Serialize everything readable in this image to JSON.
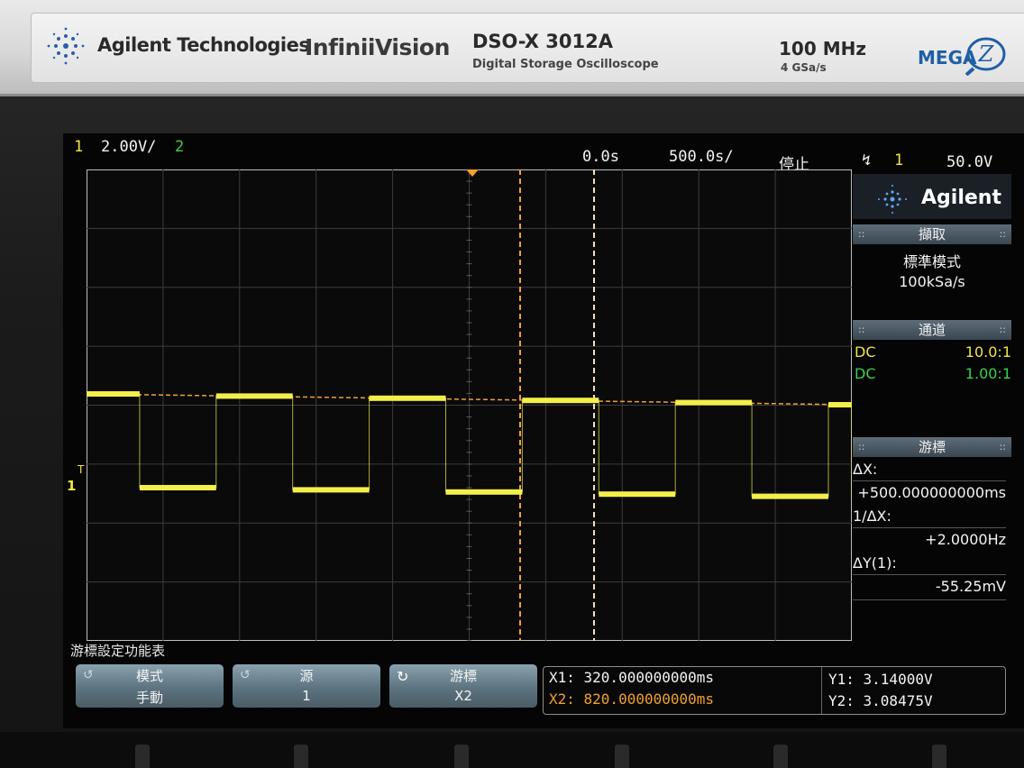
{
  "brand": {
    "maker": "Agilent Technologies",
    "series": "InfiniiVision",
    "model": "DSO-X 3012A",
    "model_subtitle": "Digital Storage Oscilloscope",
    "bandwidth": "100 MHz",
    "sample_rate": "4 GSa/s",
    "megazoom_text": "MEGA",
    "megazoom_letter": "Z"
  },
  "status_bar": {
    "ch1_number": "1",
    "ch1_scale": "2.00V/",
    "ch2_number": "2",
    "time_offset": "0.0s",
    "time_scale": "500.0s/",
    "run_state": "停止",
    "trigger_source": "1",
    "trigger_level": "50.0V"
  },
  "side_panel": {
    "logo": "Agilent",
    "acquire": {
      "title": "擷取",
      "mode": "標準模式",
      "rate": "100kSa/s"
    },
    "channels": {
      "title": "通道",
      "rows": [
        {
          "coupling": "DC",
          "probe": "10.0:1",
          "color": "#f0e640"
        },
        {
          "coupling": "DC",
          "probe": "1.00:1",
          "color": "#3ad24a"
        }
      ]
    },
    "cursors": {
      "title": "游標",
      "dx_label": "ΔX:",
      "dx_value": "+500.000000000ms",
      "inv_dx_label": "1/ΔX:",
      "inv_dx_value": "+2.0000Hz",
      "dy_label": "ΔY(1):",
      "dy_value": "-55.25mV"
    }
  },
  "waveform": {
    "channel_label": "1",
    "trigger_marker": "T",
    "color": "#f3ef4a",
    "cursor_color": "#f0a030",
    "period_divisions": 2,
    "duty_high_fraction": 0.5
  },
  "softkeys": {
    "menu_title": "游標設定功能表",
    "keys": [
      {
        "top": "模式",
        "bottom": "手動"
      },
      {
        "top": "源",
        "bottom": "1"
      },
      {
        "top": "游標",
        "bottom": "X2"
      }
    ]
  },
  "cursor_readout": {
    "x1": "X1: 320.000000000ms",
    "x2": "X2: 820.000000000ms",
    "y1": "Y1: 3.14000V",
    "y2": "Y2: 3.08475V"
  }
}
